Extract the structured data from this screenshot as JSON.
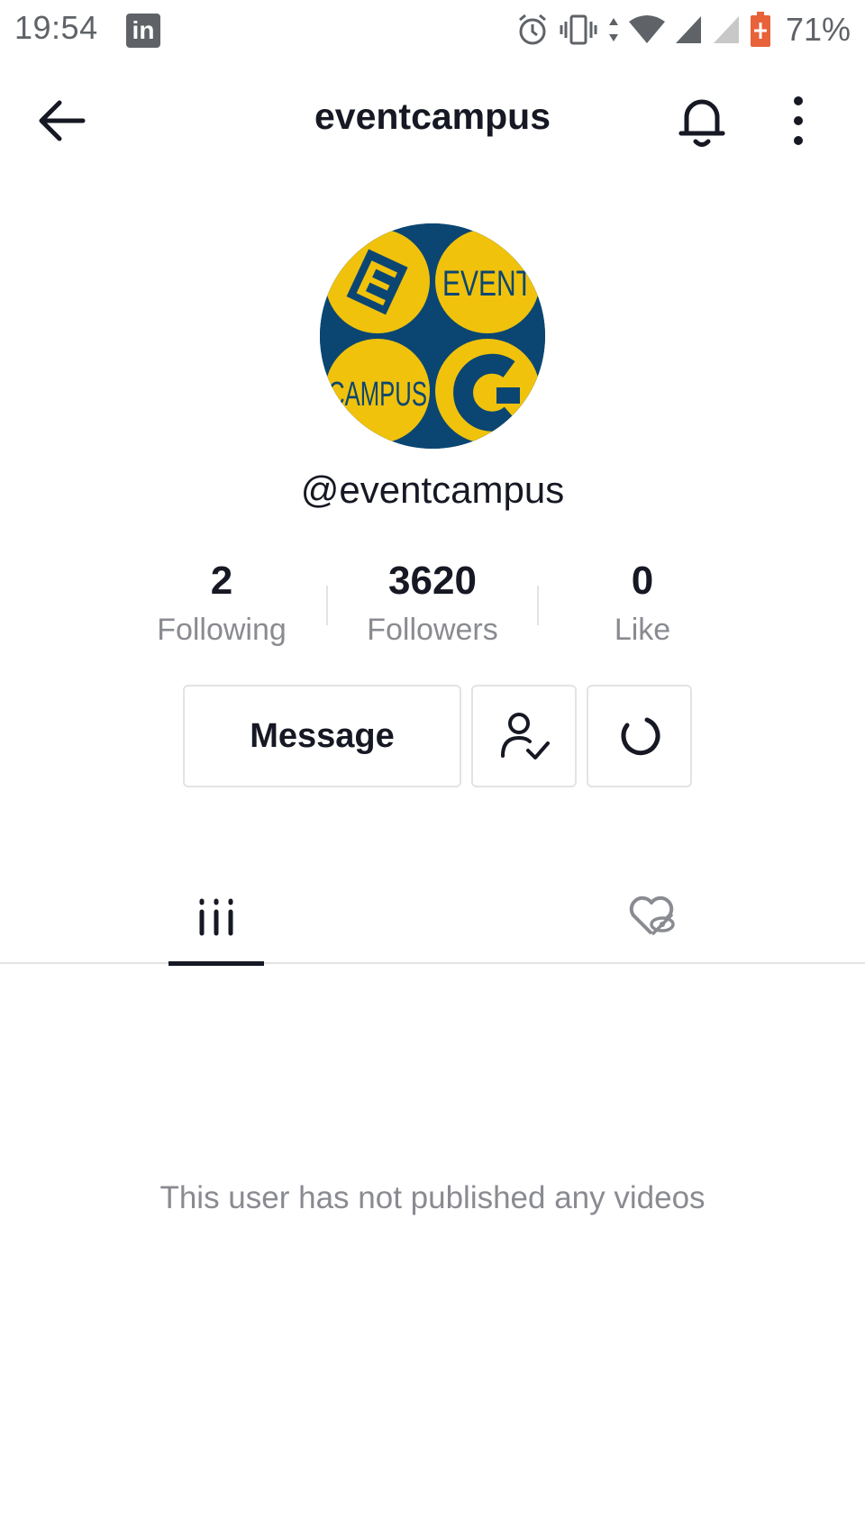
{
  "status_bar": {
    "time": "19:54",
    "app_badge": "in",
    "battery_pct": "71%"
  },
  "header": {
    "title": "eventcampus"
  },
  "avatar": {
    "text_top": "EVENT",
    "text_bottom": "CAMPUS",
    "letter_e": "E",
    "letter_c": "C",
    "colors": {
      "background": "#0b4672",
      "yellow": "#f0c20c"
    }
  },
  "profile": {
    "handle": "@eventcampus"
  },
  "stats": [
    {
      "value": "2",
      "label": "Following"
    },
    {
      "value": "3620",
      "label": "Followers"
    },
    {
      "value": "0",
      "label": "Like"
    }
  ],
  "actions": {
    "message_label": "Message",
    "friend_icon": "user-check-icon",
    "suggest_icon": "refresh-icon"
  },
  "tabs": {
    "videos_icon": "grid-icon",
    "liked_icon": "heart-hidden-icon",
    "active": "videos"
  },
  "empty_state": {
    "text": "This user has not published any videos"
  }
}
